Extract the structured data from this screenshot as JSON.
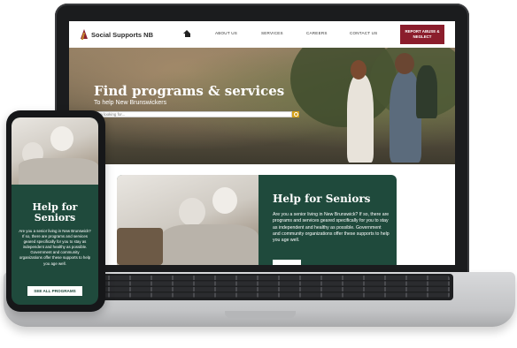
{
  "site": {
    "logo_text": "Social Supports NB",
    "nav": [
      "ABOUT US",
      "SERVICES",
      "CAREERS",
      "CONTACT US"
    ],
    "report_button": "REPORT ABUSE & NEGLECT"
  },
  "hero": {
    "title": "Find programs & services",
    "subtitle": "To help New Brunswickers",
    "search_placeholder": "I'm looking for..."
  },
  "card": {
    "title": "Help for Seniors",
    "body": "Are you a senior living in New Brunswick? If so, there are programs and services geared specifically for you to stay as independent and healthy as possible. Government and community organizations offer these supports to help you age well."
  },
  "phone": {
    "title": "Help for Seniors",
    "body": "Are you a senior living in New Brunswick? If so, there are programs and services geared specifically for you to stay as independent and healthy as possible. Government and community organizations offer these supports to help you age well.",
    "button": "SEE ALL PROGRAMS"
  },
  "colors": {
    "brand_green": "#1f4a3c",
    "brand_red": "#8b1d2c",
    "search_accent": "#d4a017"
  }
}
